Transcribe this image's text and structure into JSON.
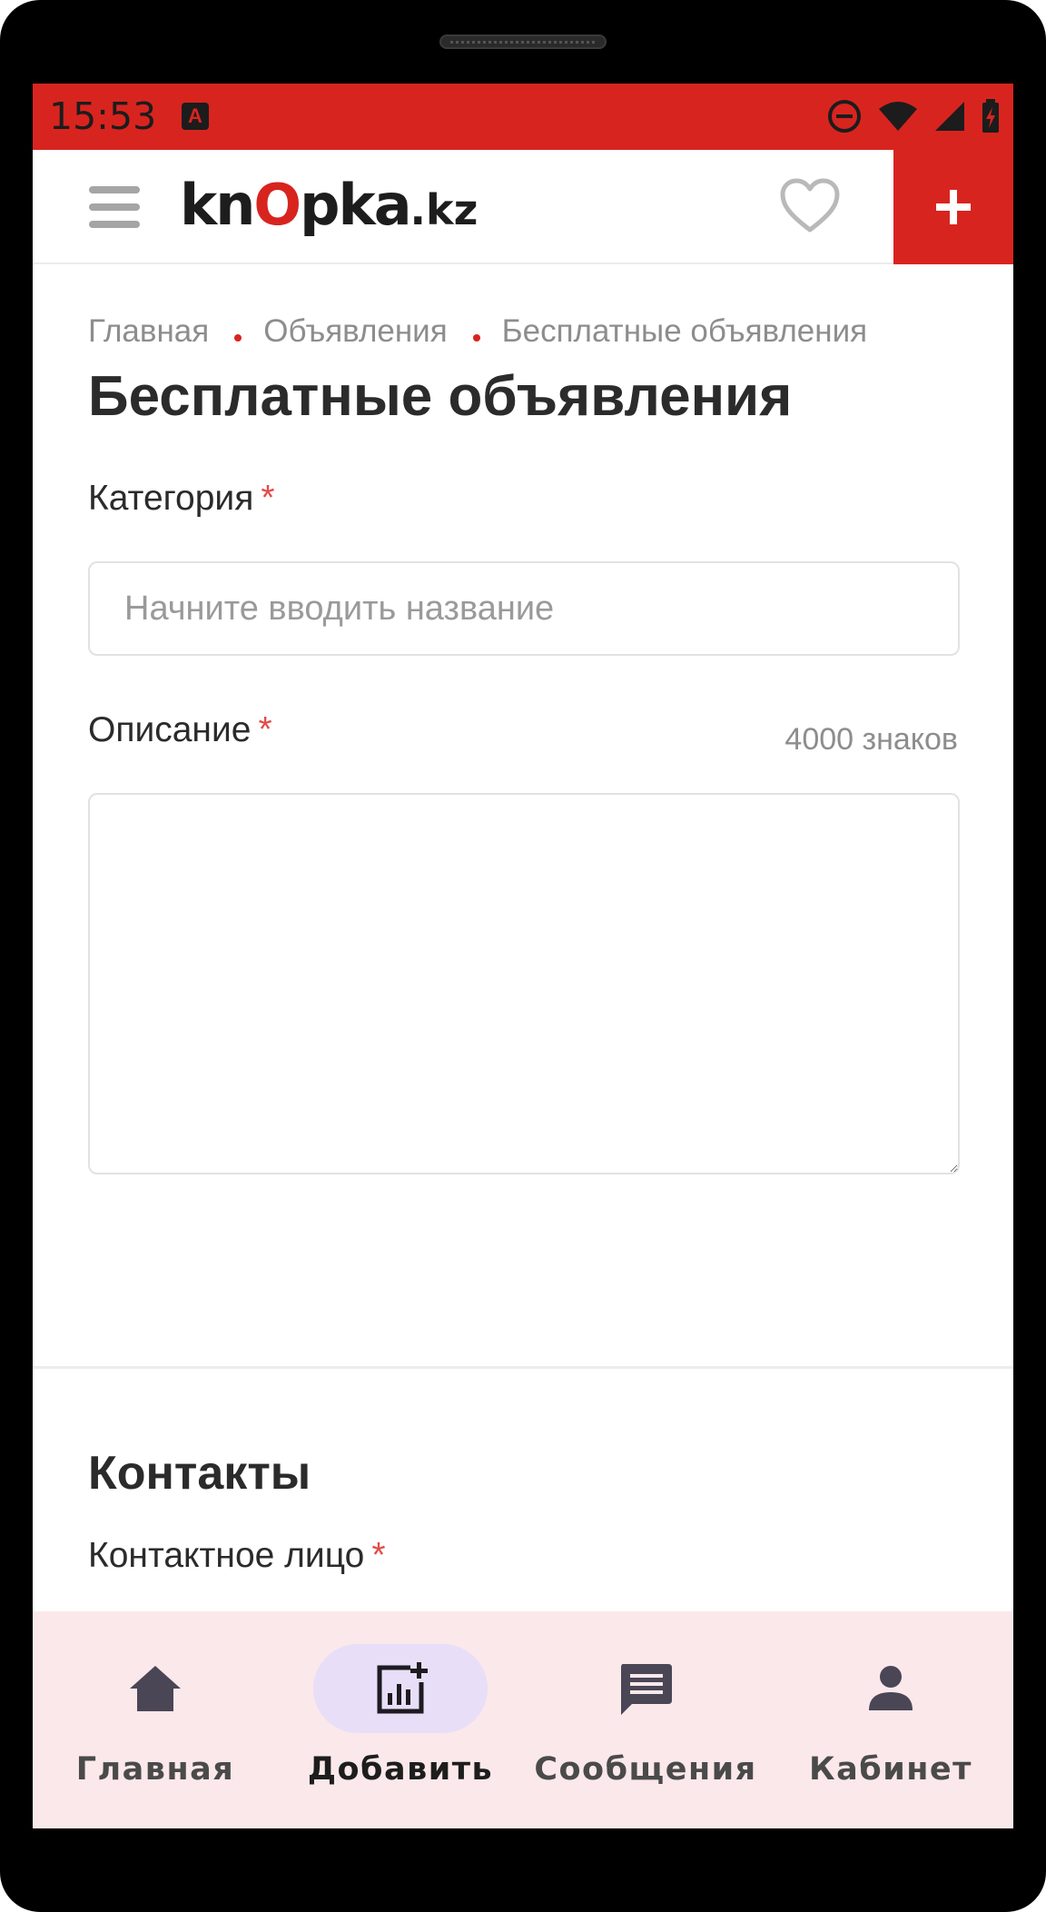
{
  "status_bar": {
    "time": "15:53",
    "app_icon_letter": "A"
  },
  "header": {
    "logo": {
      "part1": "kn",
      "o": "O",
      "part2": "pka",
      "kz": ".kz"
    },
    "menu_icon": "hamburger-icon",
    "favorite_icon": "heart-icon",
    "add_icon": "plus-icon"
  },
  "breadcrumb": [
    "Главная",
    "Объявления",
    "Бесплатные объявления"
  ],
  "page_title": "Бесплатные объявления",
  "form": {
    "category": {
      "label": "Категория",
      "required": "*",
      "placeholder": "Начните вводить название",
      "value": ""
    },
    "description": {
      "label": "Описание",
      "required": "*",
      "counter": "4000 знаков",
      "value": ""
    }
  },
  "contacts": {
    "title": "Контакты",
    "contact_person": {
      "label": "Контактное лицо",
      "required": "*",
      "value": ""
    }
  },
  "bottom_nav": [
    {
      "label": "Главная",
      "icon": "home-icon",
      "active": false
    },
    {
      "label": "Добавить",
      "icon": "add-listing-icon",
      "active": true
    },
    {
      "label": "Сообщения",
      "icon": "message-icon",
      "active": false
    },
    {
      "label": "Кабинет",
      "icon": "person-icon",
      "active": false
    }
  ],
  "colors": {
    "brand_red": "#d8241f",
    "nav_bg": "#fbe8ea",
    "active_pill": "#e8def8",
    "required_star": "#e24b47"
  }
}
